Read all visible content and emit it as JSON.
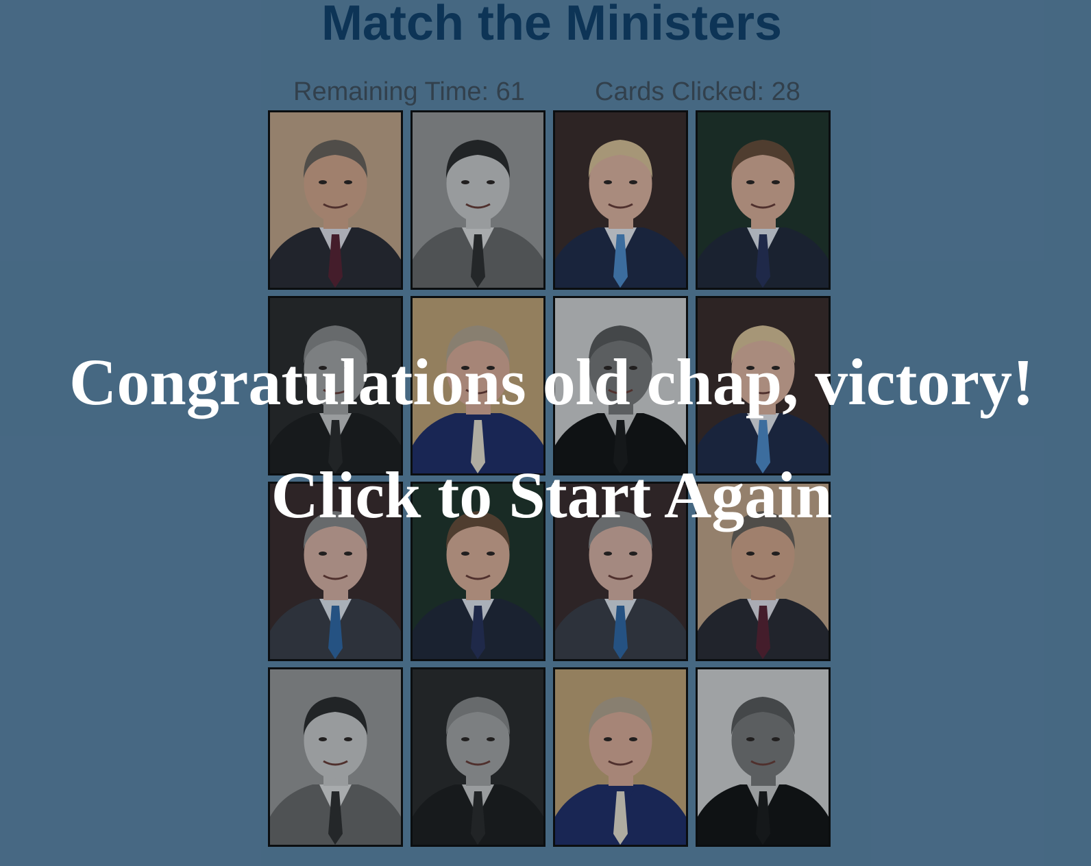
{
  "game": {
    "title": "Match the Ministers",
    "remaining_time_text": "Remaining Time: 61",
    "cards_clicked_text": "Cards Clicked: 28"
  },
  "board": {
    "rows": 4,
    "cols": 4,
    "cards": [
      {
        "minister": "gordon-brown",
        "tone": "color",
        "bg": "#c9a98a",
        "skin": "#d9a98c",
        "hair": "#6b6259",
        "suit": "#2a2a32",
        "shirt": "#e8e6ee",
        "tie": "#5a2030"
      },
      {
        "minister": "anthony-eden",
        "tone": "bw",
        "bg": "#9a9a9a",
        "skin": "#cfcfcf",
        "hair": "#2a2a2a",
        "suit": "#6a6a6a",
        "shirt": "#e4e4e4",
        "tie": "#2e2e2e"
      },
      {
        "minister": "boris-johnson",
        "tone": "color",
        "bg": "#3a2a26",
        "skin": "#e6b8a2",
        "hair": "#e2c89a",
        "suit": "#1f2a48",
        "shirt": "#eef0f6",
        "tie": "#4f8fd0"
      },
      {
        "minister": "david-cameron",
        "tone": "color",
        "bg": "#1f3328",
        "skin": "#e2b29a",
        "hair": "#6a4d36",
        "suit": "#202638",
        "shirt": "#e8ecf4",
        "tie": "#26305a"
      },
      {
        "minister": "neville-chamberlain",
        "tone": "bw",
        "bg": "#2a2a2a",
        "skin": "#a8a8a8",
        "hair": "#8a8a8a",
        "suit": "#1c1c1c",
        "shirt": "#d0d0d0",
        "tie": "#2a2a2a"
      },
      {
        "minister": "theresa-may",
        "tone": "color",
        "bg": "#c8a878",
        "skin": "#e2b09a",
        "hair": "#b8a890",
        "suit": "#1e2c6a",
        "shirt": "#1e2c6a",
        "tie": "#efe6d4"
      },
      {
        "minister": "winston-churchill",
        "tone": "bw",
        "bg": "#d8d8d8",
        "skin": "#7a7a7a",
        "hair": "#5a5a5a",
        "suit": "#111111",
        "shirt": "#cfcfcf",
        "tie": "#1a1a1a"
      },
      {
        "minister": "boris-johnson",
        "tone": "color",
        "bg": "#3a2a26",
        "skin": "#e6b8a2",
        "hair": "#e2c89a",
        "suit": "#1f2a48",
        "shirt": "#eef0f6",
        "tie": "#4f8fd0"
      },
      {
        "minister": "john-major",
        "tone": "color",
        "bg": "#3a2a2a",
        "skin": "#e0b6a6",
        "hair": "#8a8a8a",
        "suit": "#3a3d46",
        "shirt": "#e6ecf4",
        "tie": "#2f6aaa"
      },
      {
        "minister": "david-cameron",
        "tone": "color",
        "bg": "#1f3328",
        "skin": "#e2b29a",
        "hair": "#6a4d36",
        "suit": "#202638",
        "shirt": "#e8ecf4",
        "tie": "#26305a"
      },
      {
        "minister": "john-major",
        "tone": "color",
        "bg": "#3a2a2a",
        "skin": "#e0b6a6",
        "hair": "#8a8a8a",
        "suit": "#3a3d46",
        "shirt": "#e6ecf4",
        "tie": "#2f6aaa"
      },
      {
        "minister": "gordon-brown",
        "tone": "color",
        "bg": "#c9a98a",
        "skin": "#d9a98c",
        "hair": "#6b6259",
        "suit": "#2a2a32",
        "shirt": "#e8e6ee",
        "tie": "#5a2030"
      },
      {
        "minister": "anthony-eden",
        "tone": "bw",
        "bg": "#9a9a9a",
        "skin": "#cfcfcf",
        "hair": "#2a2a2a",
        "suit": "#6a6a6a",
        "shirt": "#e4e4e4",
        "tie": "#2e2e2e"
      },
      {
        "minister": "neville-chamberlain",
        "tone": "bw",
        "bg": "#2a2a2a",
        "skin": "#a8a8a8",
        "hair": "#8a8a8a",
        "suit": "#1c1c1c",
        "shirt": "#d0d0d0",
        "tie": "#2a2a2a"
      },
      {
        "minister": "theresa-may",
        "tone": "color",
        "bg": "#c8a878",
        "skin": "#e2b09a",
        "hair": "#b8a890",
        "suit": "#1e2c6a",
        "shirt": "#1e2c6a",
        "tie": "#efe6d4"
      },
      {
        "minister": "winston-churchill",
        "tone": "bw",
        "bg": "#d8d8d8",
        "skin": "#7a7a7a",
        "hair": "#5a5a5a",
        "suit": "#111111",
        "shirt": "#cfcfcf",
        "tie": "#1a1a1a"
      }
    ]
  },
  "overlay": {
    "victory_text": "Congratulations old chap, victory!",
    "restart_text": "Click to Start Again"
  },
  "colors": {
    "background": "#557d9c",
    "title": "#0c3a63",
    "stats": "#3b4a57",
    "overlay_text": "#ffffff"
  }
}
